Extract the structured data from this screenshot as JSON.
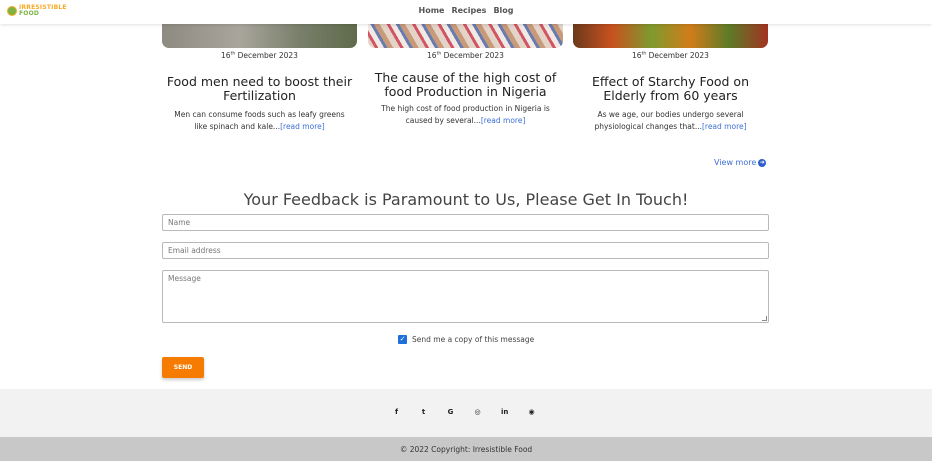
{
  "brand": {
    "line1": "IRRESISTIBLE",
    "line2": "FOOD"
  },
  "nav": {
    "home": "Home",
    "recipes": "Recipes",
    "blog": "Blog"
  },
  "cards": [
    {
      "date_day": "16",
      "date_sup": "th",
      "date_rest": " December 2023",
      "title": "Food men need to boost their Fertilization",
      "text": "Men can consume foods such as leafy greens like spinach and kale...",
      "link": "[read more]"
    },
    {
      "date_day": "16",
      "date_sup": "th",
      "date_rest": " December 2023",
      "title": "The cause of the high cost of food Production in Nigeria",
      "text": "The high cost of food production in Nigeria is caused by several...",
      "link": "[read more]"
    },
    {
      "date_day": "16",
      "date_sup": "th",
      "date_rest": " December 2023",
      "title": "Effect of Starchy Food on Elderly from 60 years",
      "text": "As we age, our bodies undergo several physiological changes that...",
      "link": "[read more]"
    }
  ],
  "view_more": "View more",
  "feedback": {
    "heading": "Your Feedback is Paramount to Us, Please Get In Touch!",
    "name_placeholder": "Name",
    "email_placeholder": "Email address",
    "message_placeholder": "Message",
    "copy_label": "Send me a copy of this message",
    "copy_checked": true,
    "send_label": "SEND"
  },
  "social": {
    "facebook": "f",
    "twitter": "t",
    "google": "G",
    "instagram": "◎",
    "linkedin": "in",
    "github": "◉"
  },
  "footer": {
    "copyright": "© 2022 Copyright: Irresistible Food"
  },
  "colors": {
    "accent": "#f57c00",
    "link": "#3f6fd6",
    "checkbox": "#1e6fd9"
  }
}
